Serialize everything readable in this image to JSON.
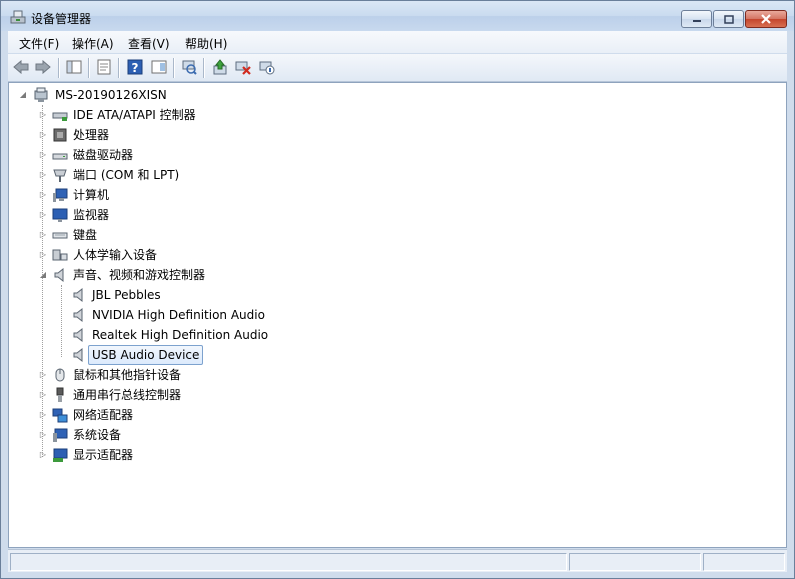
{
  "window": {
    "title": "设备管理器"
  },
  "menu": [
    {
      "label": "文件(F)"
    },
    {
      "label": "操作(A)"
    },
    {
      "label": "查看(V)"
    },
    {
      "label": "帮助(H)"
    }
  ],
  "toolbar": {
    "icons": [
      "back-arrow-icon",
      "forward-arrow-icon",
      "show-hide-tree-icon",
      "properties-icon",
      "help-icon",
      "action-pane-icon",
      "scan-hardware-icon",
      "update-driver-icon",
      "uninstall-device-icon",
      "disable-device-icon"
    ]
  },
  "tree": {
    "root": "MS-20190126XISN",
    "categories": [
      {
        "label": "IDE ATA/ATAPI 控制器",
        "icon": "ide-controller-icon"
      },
      {
        "label": "处理器",
        "icon": "processor-icon"
      },
      {
        "label": "磁盘驱动器",
        "icon": "disk-drive-icon"
      },
      {
        "label": "端口 (COM 和 LPT)",
        "icon": "port-icon"
      },
      {
        "label": "计算机",
        "icon": "computer-icon"
      },
      {
        "label": "监视器",
        "icon": "monitor-icon"
      },
      {
        "label": "键盘",
        "icon": "keyboard-icon"
      },
      {
        "label": "人体学输入设备",
        "icon": "hid-icon"
      },
      {
        "label": "声音、视频和游戏控制器",
        "icon": "speaker-icon",
        "expanded": true,
        "children": [
          {
            "label": "JBL Pebbles"
          },
          {
            "label": "NVIDIA High Definition Audio"
          },
          {
            "label": "Realtek High Definition Audio"
          },
          {
            "label": "USB Audio Device",
            "selected": true
          }
        ]
      },
      {
        "label": "鼠标和其他指针设备",
        "icon": "mouse-icon"
      },
      {
        "label": "通用串行总线控制器",
        "icon": "usb-icon"
      },
      {
        "label": "网络适配器",
        "icon": "network-adapter-icon"
      },
      {
        "label": "系统设备",
        "icon": "system-device-icon"
      },
      {
        "label": "显示适配器",
        "icon": "display-adapter-icon"
      }
    ]
  }
}
